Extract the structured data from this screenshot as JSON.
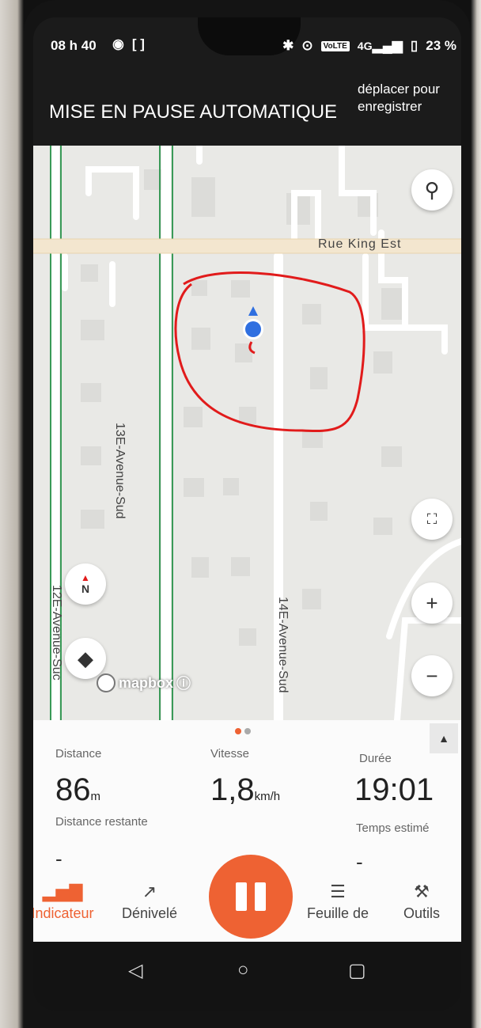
{
  "status_bar": {
    "time": "08 h 40",
    "network": "4G",
    "volte": "VoLTE",
    "battery": "23 %"
  },
  "header": {
    "title": "MISE EN PAUSE AUTOMATIQUE",
    "hint": "déplacer pour enregistrer"
  },
  "map": {
    "streets": {
      "rue_king": "Rue King Est",
      "avenue_13": "13E-Avenue-Sud",
      "avenue_14": "14E-Avenue-Sud",
      "avenue_12": "12E-Avenue-Suc"
    },
    "compass": "N",
    "attribution": "mapbox",
    "controls": {
      "zoom_in": "+",
      "zoom_out": "−"
    }
  },
  "stats": {
    "distance": {
      "label": "Distance",
      "value": "86",
      "unit": "m"
    },
    "speed": {
      "label": "Vitesse",
      "value": "1,8",
      "unit": "km/h"
    },
    "duration": {
      "label": "Durée",
      "value": "19:01"
    },
    "remaining": {
      "label": "Distance restante",
      "value": "-"
    },
    "estimated": {
      "label": "Temps estimé",
      "value": "-"
    }
  },
  "tabs": [
    {
      "label": "Indicateur",
      "icon": "bar-chart-icon",
      "active": true
    },
    {
      "label": "Dénivelé",
      "icon": "trend-icon",
      "active": false
    },
    {
      "label": "Feuille de",
      "icon": "list-icon",
      "active": false
    },
    {
      "label": "Outils",
      "icon": "tools-icon",
      "active": false
    }
  ],
  "colors": {
    "accent": "#ee6233",
    "location": "#2f6fe0",
    "annotation": "#e11b1b"
  }
}
